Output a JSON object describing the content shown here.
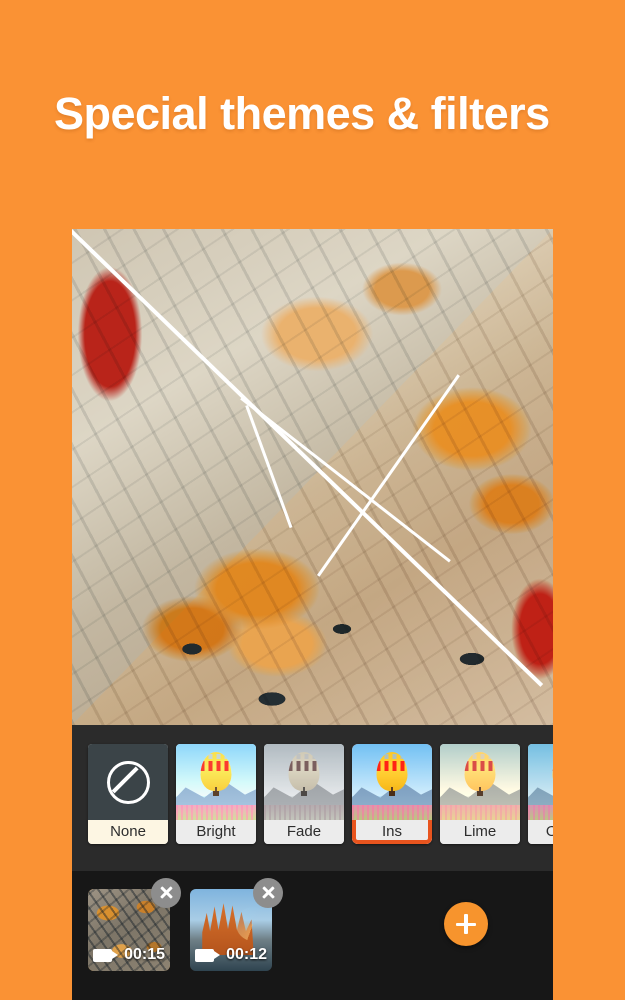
{
  "theme": {
    "background_color": "#FA9234",
    "accent_color": "#F7942D",
    "selection_color": "#E8541E",
    "clip_selection_color": "#F2A33C",
    "panel_color": "#2B2B2B",
    "timeline_color": "#171717"
  },
  "headline": {
    "text": "Special themes & filters"
  },
  "preview": {
    "label": "video-preview-before-after-split",
    "divider_style": "zigzag-white-lines"
  },
  "filters": {
    "items": [
      {
        "label": "None",
        "icon": "no-filter-icon",
        "selected": false
      },
      {
        "label": "Bright",
        "icon": "balloon-thumbnail",
        "selected": false
      },
      {
        "label": "Fade",
        "icon": "balloon-thumbnail",
        "selected": false
      },
      {
        "label": "Ins",
        "icon": "balloon-thumbnail",
        "selected": true
      },
      {
        "label": "Lime",
        "icon": "balloon-thumbnail",
        "selected": false
      },
      {
        "label": "Ocean",
        "icon": "balloon-thumbnail",
        "selected": false
      }
    ]
  },
  "timeline": {
    "clips": [
      {
        "duration": "00:15",
        "thumbnail": "food-burgers-thumbnail",
        "selected": true,
        "remove_icon": "close-icon",
        "media_icon": "video-camera-icon"
      },
      {
        "duration": "00:12",
        "thumbnail": "sagrada-familia-thumbnail",
        "selected": false,
        "remove_icon": "close-icon",
        "media_icon": "video-camera-icon"
      }
    ],
    "add_button": {
      "icon": "plus-icon",
      "label": "+"
    }
  }
}
